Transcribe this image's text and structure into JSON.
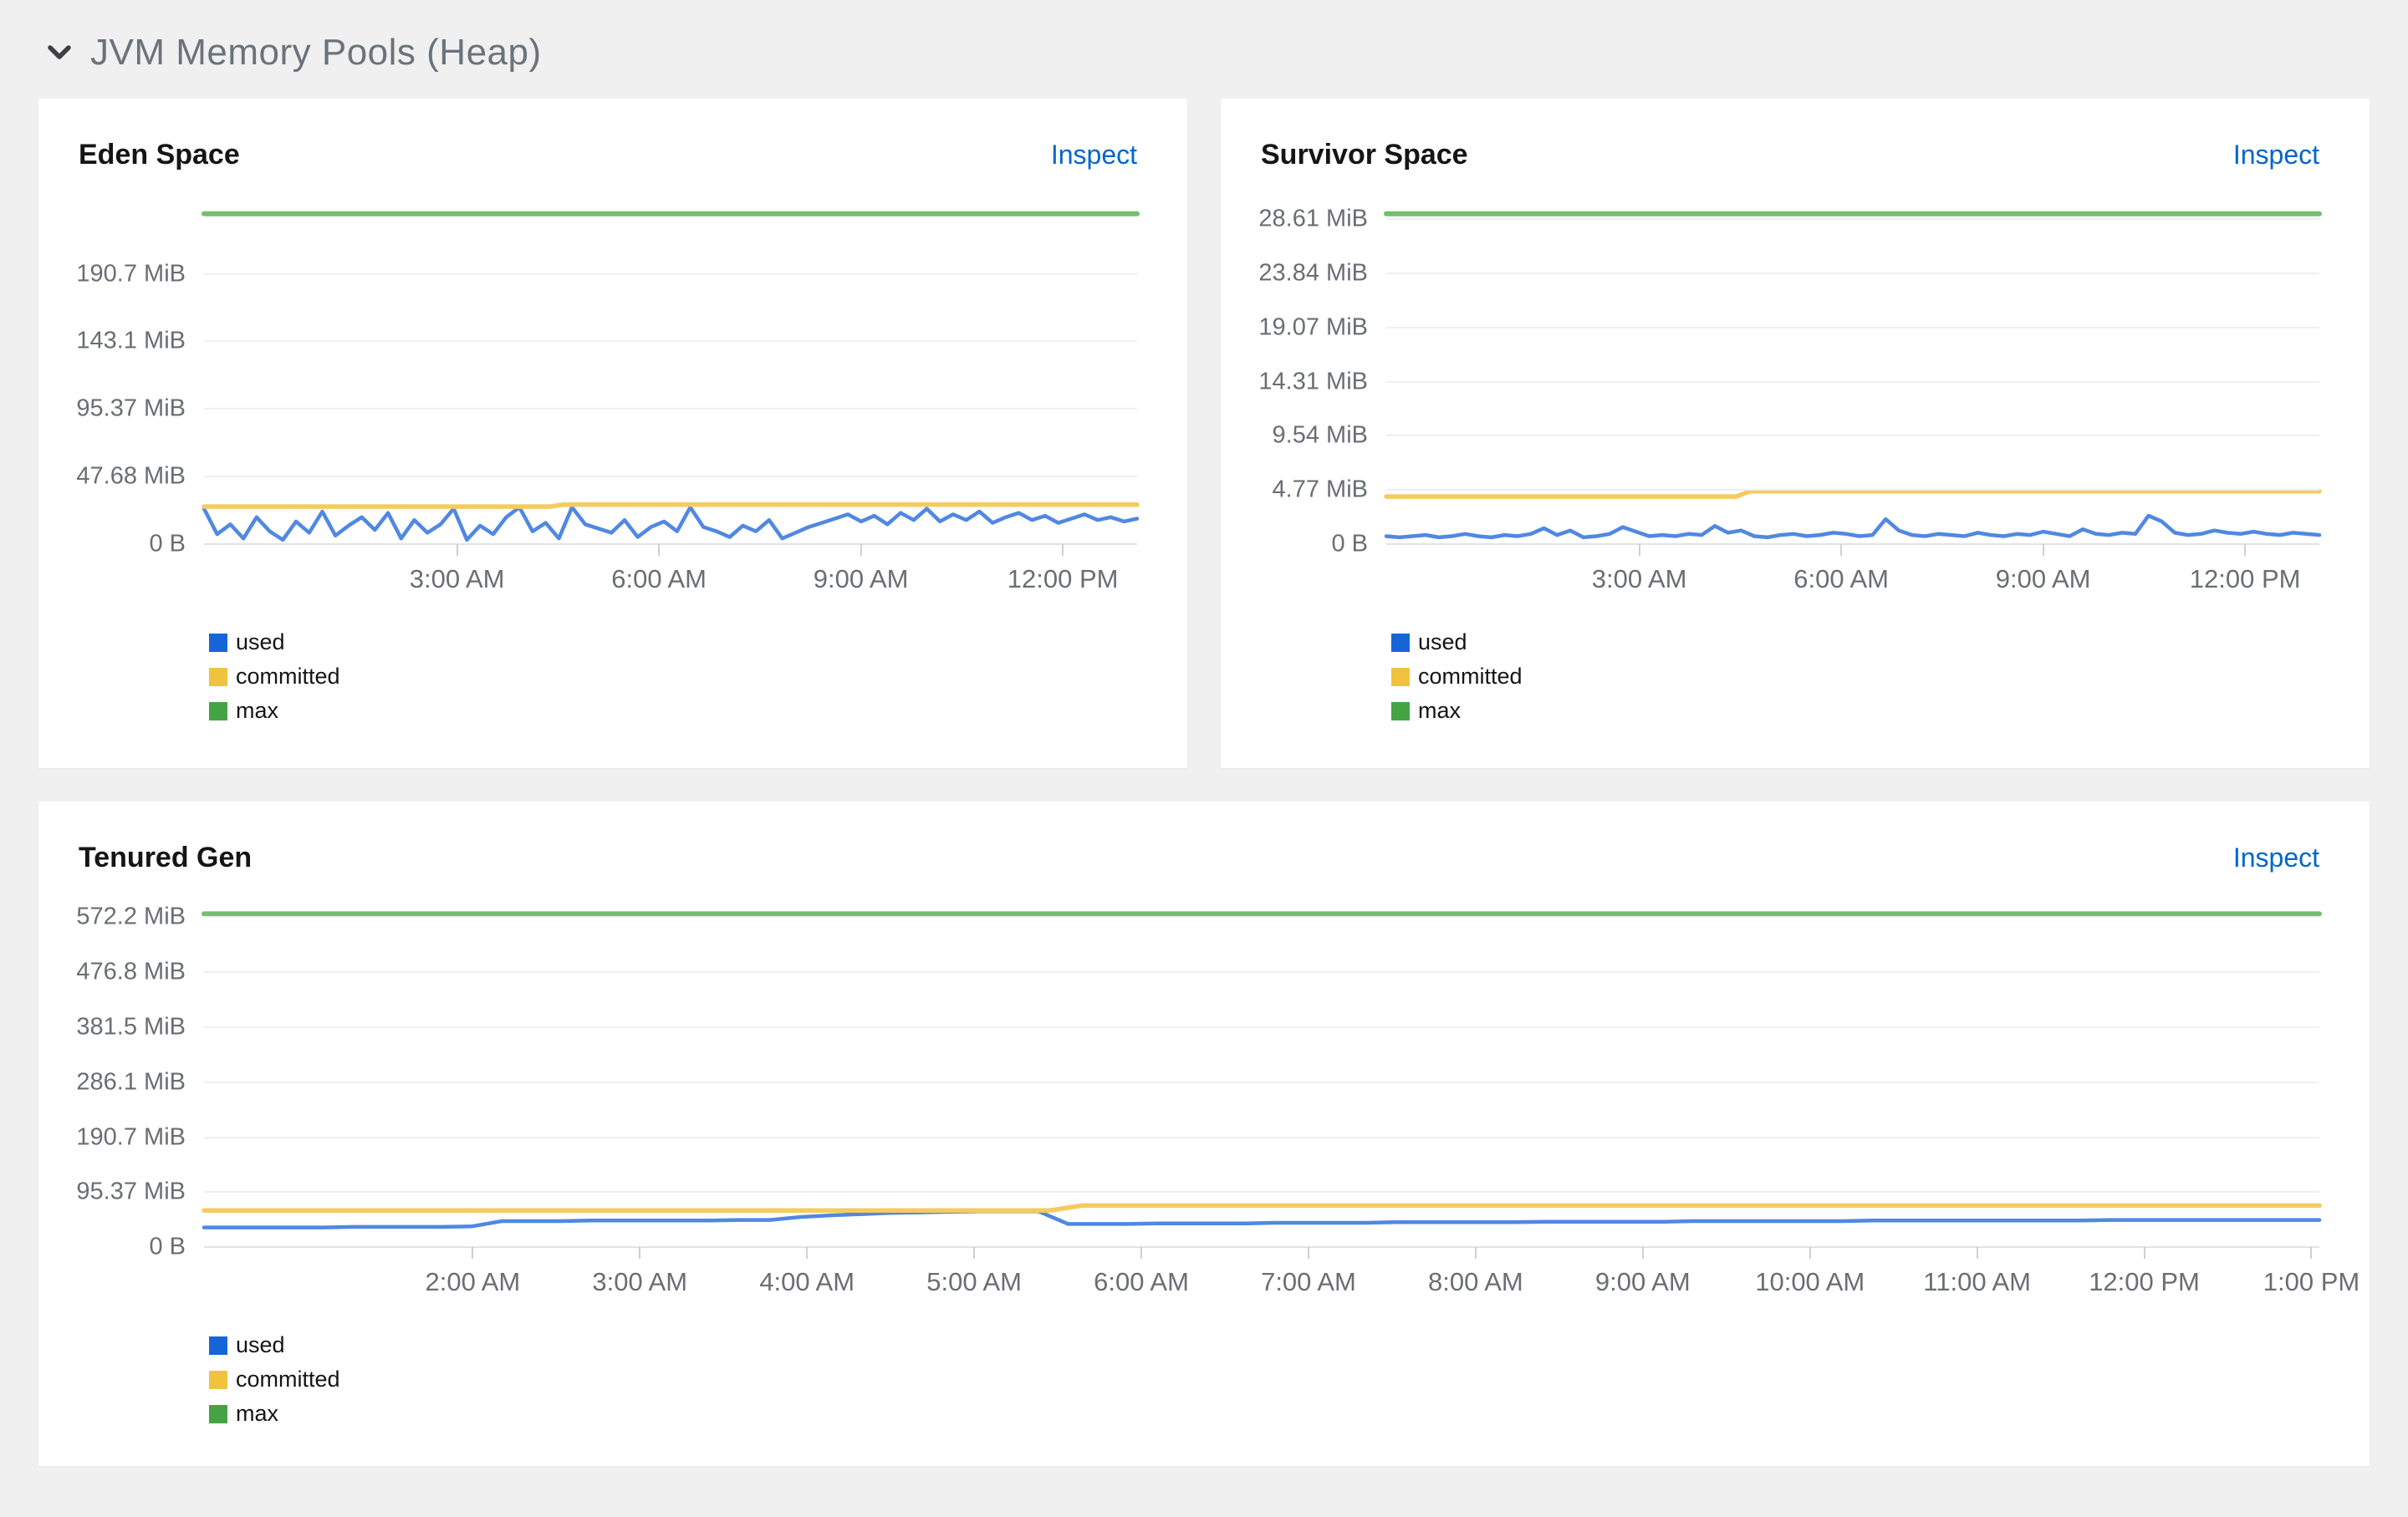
{
  "section": {
    "title": "JVM Memory Pools (Heap)"
  },
  "colors": {
    "used": {
      "line": "#5088e2",
      "swatch": "#1665d8"
    },
    "committed": {
      "line": "#f5cb5f",
      "swatch": "#f0c33e"
    },
    "max": {
      "line": "#74bf6e",
      "swatch": "#44a444"
    },
    "link": "#0066cc",
    "section_title": "#6a737b",
    "axis_label": "#6a6e73"
  },
  "chart_data": [
    {
      "id": "eden-space",
      "type": "line",
      "title": "Eden Space",
      "inspect_label": "Inspect",
      "unit": "MiB",
      "ylim": [
        0,
        237
      ],
      "grid": true,
      "legend_position": "bottom-left",
      "yticks": [
        {
          "value": 0,
          "label": "0 B"
        },
        {
          "value": 47.68,
          "label": "47.68 MiB"
        },
        {
          "value": 95.37,
          "label": "95.37 MiB"
        },
        {
          "value": 143.1,
          "label": "143.1 MiB"
        },
        {
          "value": 190.7,
          "label": "190.7 MiB"
        }
      ],
      "xticks": [
        {
          "frac": 0.158,
          "label": "3:00 AM"
        },
        {
          "frac": 0.408,
          "label": "6:00 AM"
        },
        {
          "frac": 0.658,
          "label": "9:00 AM"
        },
        {
          "frac": 0.908,
          "label": "12:00 PM"
        }
      ],
      "legend": [
        "used",
        "committed",
        "max"
      ],
      "series": [
        {
          "name": "used",
          "color": "used",
          "values": [
            25,
            7,
            14,
            4,
            19,
            9,
            3,
            16,
            8,
            23,
            6,
            13,
            19,
            10,
            22,
            4,
            17,
            8,
            14,
            25,
            3,
            13,
            7,
            19,
            26,
            9,
            15,
            4,
            26,
            14,
            11,
            8,
            17,
            5,
            12,
            16,
            9,
            26,
            12,
            9,
            5,
            13,
            9,
            17,
            4,
            8,
            12,
            15,
            18,
            21,
            16,
            20,
            14,
            22,
            17,
            25,
            16,
            21,
            17,
            23,
            15,
            19,
            22,
            17,
            20,
            15,
            18,
            21,
            17,
            19,
            16,
            18
          ]
        },
        {
          "name": "committed",
          "color": "committed",
          "points": [
            [
              0,
              26.5
            ],
            [
              0.37,
              26.5
            ],
            [
              0.385,
              27.8
            ],
            [
              1,
              27.8
            ]
          ]
        },
        {
          "name": "max",
          "color": "max",
          "points": [
            [
              0,
              233
            ],
            [
              1,
              233
            ]
          ]
        }
      ]
    },
    {
      "id": "survivor-space",
      "type": "line",
      "title": "Survivor Space",
      "inspect_label": "Inspect",
      "unit": "MiB",
      "ylim": [
        0,
        29.6
      ],
      "grid": true,
      "legend_position": "bottom-left",
      "yticks": [
        {
          "value": 0,
          "label": "0 B"
        },
        {
          "value": 4.77,
          "label": "4.77 MiB"
        },
        {
          "value": 9.54,
          "label": "9.54 MiB"
        },
        {
          "value": 14.31,
          "label": "14.31 MiB"
        },
        {
          "value": 19.07,
          "label": "19.07 MiB"
        },
        {
          "value": 23.84,
          "label": "23.84 MiB"
        },
        {
          "value": 28.61,
          "label": "28.61 MiB"
        }
      ],
      "xticks": [
        {
          "frac": 0.158,
          "label": "3:00 AM"
        },
        {
          "frac": 0.408,
          "label": "6:00 AM"
        },
        {
          "frac": 0.658,
          "label": "9:00 AM"
        },
        {
          "frac": 0.908,
          "label": "12:00 PM"
        }
      ],
      "legend": [
        "used",
        "committed",
        "max"
      ],
      "series": [
        {
          "name": "used",
          "color": "used",
          "values": [
            0.7,
            0.6,
            0.7,
            0.8,
            0.6,
            0.7,
            0.9,
            0.7,
            0.6,
            0.8,
            0.7,
            0.9,
            1.4,
            0.8,
            1.2,
            0.6,
            0.7,
            0.9,
            1.5,
            1.1,
            0.7,
            0.8,
            0.7,
            0.9,
            0.8,
            1.6,
            1.0,
            1.2,
            0.7,
            0.6,
            0.8,
            0.9,
            0.7,
            0.8,
            1.0,
            0.9,
            0.7,
            0.8,
            2.2,
            1.2,
            0.8,
            0.7,
            0.9,
            0.8,
            0.7,
            1.0,
            0.8,
            0.7,
            0.9,
            0.8,
            1.1,
            0.9,
            0.7,
            1.3,
            0.9,
            0.8,
            1.0,
            0.9,
            2.5,
            2.0,
            1.0,
            0.8,
            0.9,
            1.2,
            1.0,
            0.9,
            1.1,
            0.9,
            0.8,
            1.0,
            0.9,
            0.8
          ]
        },
        {
          "name": "committed",
          "color": "committed",
          "points": [
            [
              0,
              4.19
            ],
            [
              0.375,
              4.19
            ],
            [
              0.39,
              4.66
            ],
            [
              1,
              4.66
            ]
          ]
        },
        {
          "name": "max",
          "color": "max",
          "points": [
            [
              0,
              29.1
            ],
            [
              1,
              29.1
            ]
          ]
        }
      ]
    },
    {
      "id": "tenured-gen",
      "type": "line",
      "title": "Tenured Gen",
      "inspect_label": "Inspect",
      "unit": "MiB",
      "ylim": [
        0,
        583
      ],
      "grid": true,
      "legend_position": "bottom-left",
      "yticks": [
        {
          "value": 0,
          "label": "0 B"
        },
        {
          "value": 95.37,
          "label": "95.37 MiB"
        },
        {
          "value": 190.7,
          "label": "190.7 MiB"
        },
        {
          "value": 286.1,
          "label": "286.1 MiB"
        },
        {
          "value": 381.5,
          "label": "381.5 MiB"
        },
        {
          "value": 476.8,
          "label": "476.8 MiB"
        },
        {
          "value": 572.2,
          "label": "572.2 MiB"
        }
      ],
      "xticks": [
        {
          "frac": 0.072,
          "label": "2:00 AM"
        },
        {
          "frac": 0.156,
          "label": "3:00 AM"
        },
        {
          "frac": 0.24,
          "label": "4:00 AM"
        },
        {
          "frac": 0.324,
          "label": "5:00 AM"
        },
        {
          "frac": 0.408,
          "label": "6:00 AM"
        },
        {
          "frac": 0.492,
          "label": "7:00 AM"
        },
        {
          "frac": 0.576,
          "label": "8:00 AM"
        },
        {
          "frac": 0.66,
          "label": "9:00 AM"
        },
        {
          "frac": 0.744,
          "label": "10:00 AM"
        },
        {
          "frac": 0.828,
          "label": "11:00 AM"
        },
        {
          "frac": 0.912,
          "label": "12:00 PM"
        },
        {
          "frac": 0.996,
          "label": "1:00 PM"
        }
      ],
      "legend": [
        "used",
        "committed",
        "max"
      ],
      "series": [
        {
          "name": "used",
          "color": "used",
          "values": [
            34,
            34,
            34,
            34,
            34,
            35,
            35,
            35,
            35,
            36,
            45,
            45,
            45,
            46,
            46,
            46,
            46,
            46,
            47,
            47,
            52,
            55,
            57,
            59,
            60,
            61,
            62,
            62,
            62,
            40,
            40,
            40,
            41,
            41,
            41,
            41,
            42,
            42,
            42,
            42,
            43,
            43,
            43,
            43,
            43,
            44,
            44,
            44,
            44,
            44,
            45,
            45,
            45,
            45,
            45,
            45,
            46,
            46,
            46,
            46,
            46,
            46,
            46,
            46,
            47,
            47,
            47,
            47,
            47,
            47,
            47,
            47
          ]
        },
        {
          "name": "committed",
          "color": "committed",
          "points": [
            [
              0,
              63.5
            ],
            [
              0.4,
              63.5
            ],
            [
              0.415,
              72
            ],
            [
              1,
              72
            ]
          ]
        },
        {
          "name": "max",
          "color": "max",
          "points": [
            [
              0,
              578
            ],
            [
              1,
              578
            ]
          ]
        }
      ]
    }
  ]
}
